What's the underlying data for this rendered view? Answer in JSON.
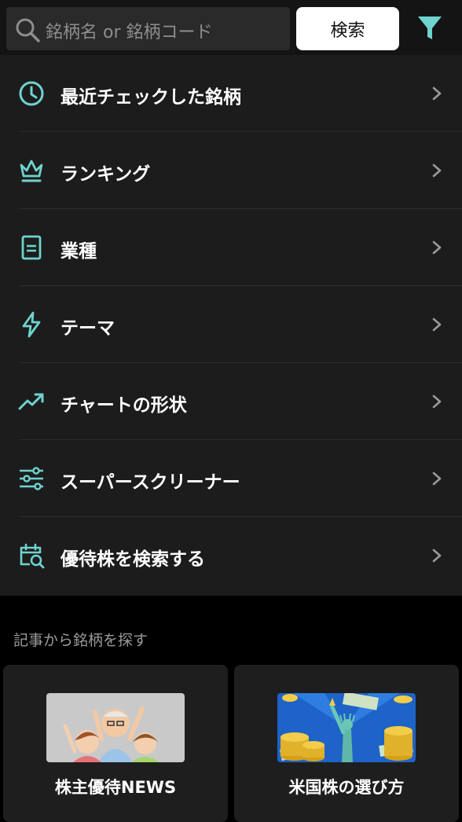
{
  "search": {
    "placeholder": "銘柄名 or 銘柄コード",
    "button_label": "検索"
  },
  "menu": {
    "items": [
      {
        "label": "最近チェックした銘柄",
        "icon": "clock-icon"
      },
      {
        "label": "ランキング",
        "icon": "crown-icon"
      },
      {
        "label": "業種",
        "icon": "document-icon"
      },
      {
        "label": "テーマ",
        "icon": "lightning-icon"
      },
      {
        "label": "チャートの形状",
        "icon": "trending-up-icon"
      },
      {
        "label": "スーパースクリーナー",
        "icon": "sliders-icon"
      },
      {
        "label": "優待株を検索する",
        "icon": "calendar-search-icon"
      }
    ]
  },
  "articles": {
    "section_title": "記事から銘柄を探す",
    "cards": [
      {
        "title": "株主優待NEWS",
        "image": "family-illustration"
      },
      {
        "title": "米国株の選び方",
        "image": "statue-of-liberty-coins-illustration"
      }
    ]
  },
  "colors": {
    "accent": "#6fd3cf",
    "background": "#000000",
    "panel": "#1c1c1c"
  }
}
